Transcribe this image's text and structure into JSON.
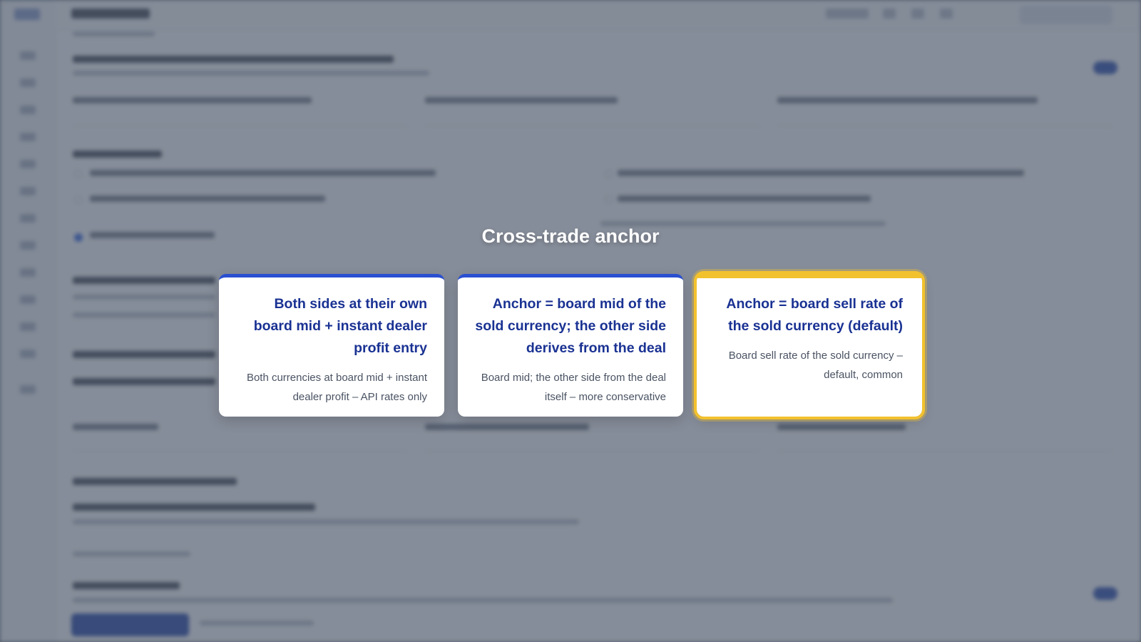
{
  "modal": {
    "title": "Cross-trade anchor",
    "options": [
      {
        "title": "Both sides at their own board mid + instant dealer profit entry",
        "description": "Both currencies at board mid + instant dealer profit – API rates only",
        "selected": false
      },
      {
        "title": "Anchor = board mid of the sold currency; the other side derives from the deal",
        "description": "Board mid; the other side from the deal itself – more conservative",
        "selected": false
      },
      {
        "title": "Anchor = board sell rate of the sold currency (default)",
        "description": "Board sell rate of the sold currency – default, common",
        "selected": true
      }
    ]
  },
  "colors": {
    "accent_blue": "#2a4fd0",
    "title_blue": "#1a3293",
    "selected_outline": "#f2c12e"
  }
}
